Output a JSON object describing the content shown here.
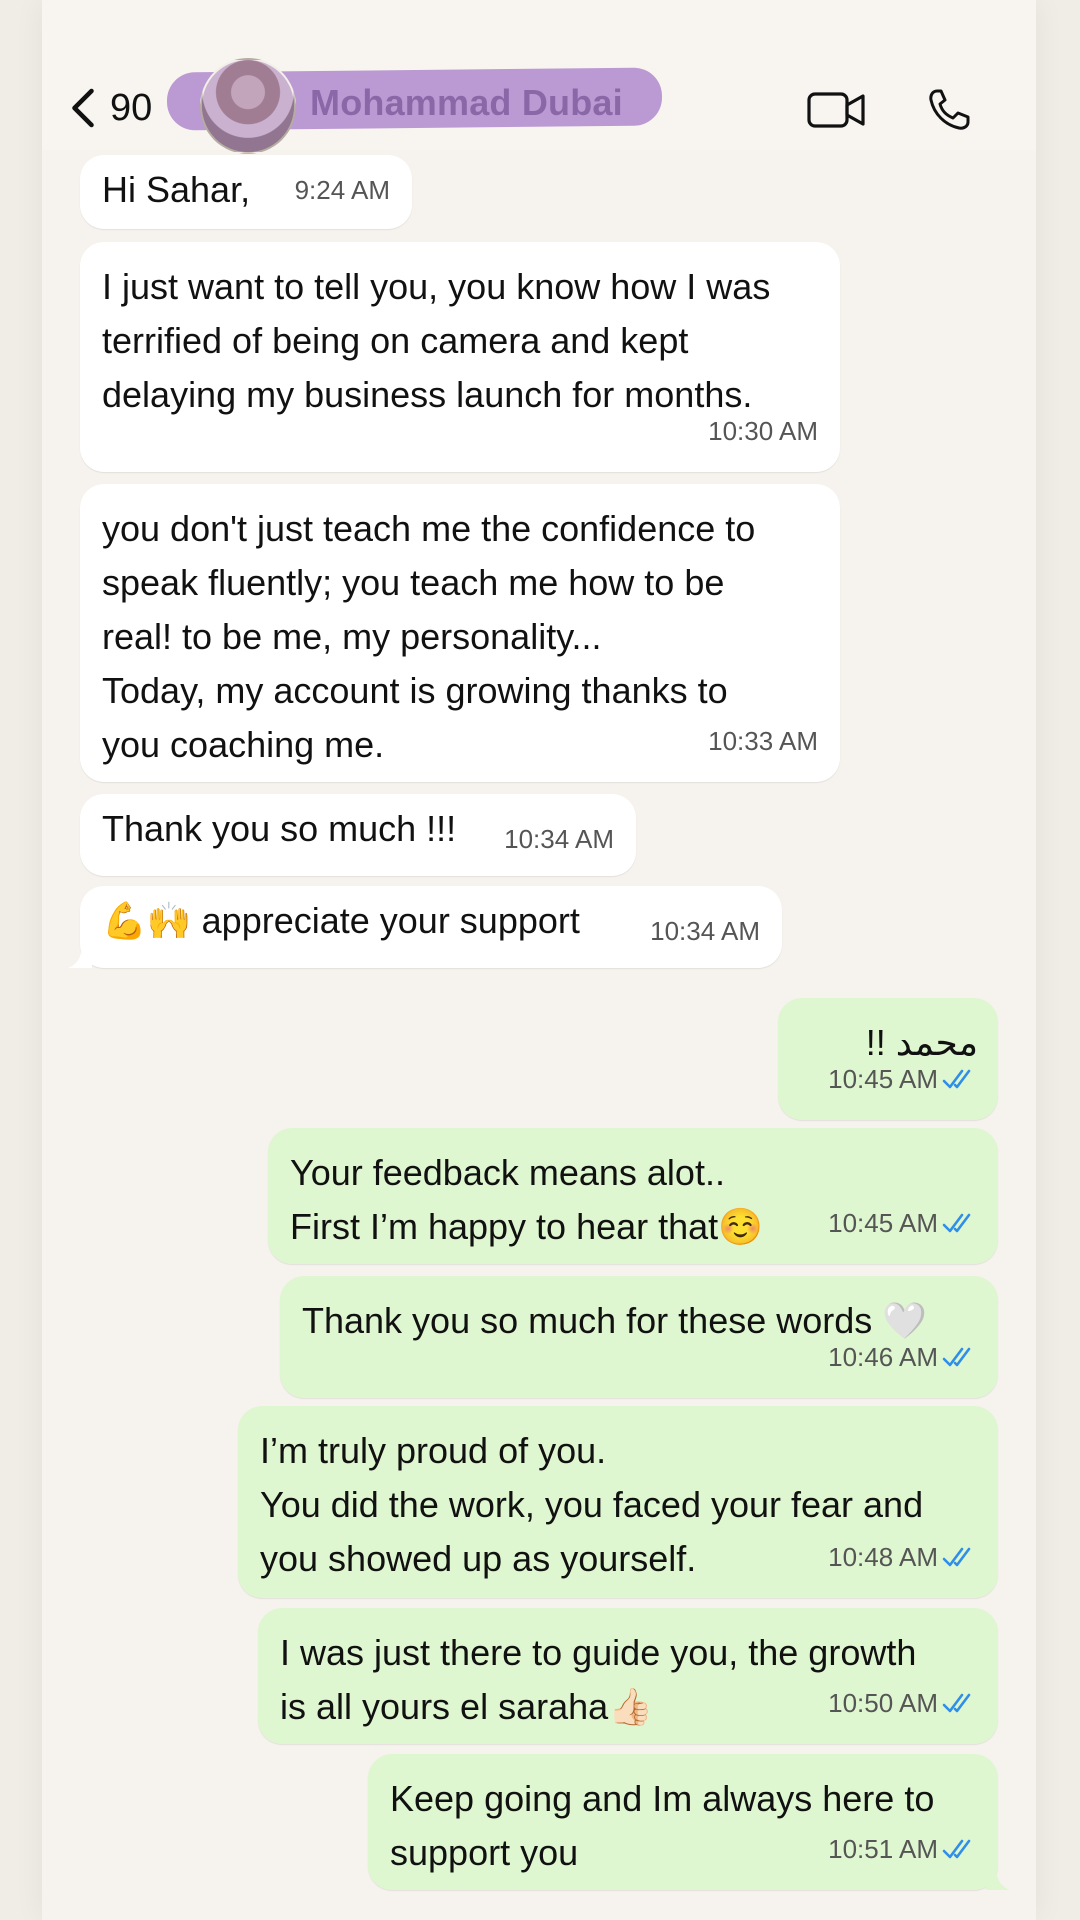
{
  "header": {
    "unread_count": "90",
    "contact_name": "Mohammad Dubai"
  },
  "messages": [
    {
      "id": "m1",
      "dir": "in",
      "text": "Hi Sahar,",
      "time": "9:24 AM"
    },
    {
      "id": "m2",
      "dir": "in",
      "text": "I just want to tell you, you know how I was\nterrified of being on camera and kept\ndelaying my business launch for months.",
      "time": "10:30 AM"
    },
    {
      "id": "m3",
      "dir": "in",
      "text": "you don't just teach me the confidence to\nspeak fluently; you teach me how to be\nreal! to be me, my personality...\nToday, my account is growing thanks to\nyou coaching me.",
      "time": "10:33 AM"
    },
    {
      "id": "m4",
      "dir": "in",
      "text": "Thank you so much !!!",
      "time": "10:34 AM"
    },
    {
      "id": "m5",
      "dir": "in",
      "text": "💪🙌 appreciate your support",
      "time": "10:34 AM"
    },
    {
      "id": "m6",
      "dir": "out",
      "text": "محمد !!",
      "time": "10:45 AM"
    },
    {
      "id": "m7",
      "dir": "out",
      "text": "Your feedback means alot..\nFirst I’m happy to hear that☺️",
      "time": "10:45 AM"
    },
    {
      "id": "m8",
      "dir": "out",
      "text": "Thank you so much for these words 🤍",
      "time": "10:46 AM"
    },
    {
      "id": "m9",
      "dir": "out",
      "text": "I’m truly proud of you.\nYou did the work, you faced your fear and\nyou showed up as yourself.",
      "time": "10:48 AM"
    },
    {
      "id": "m10",
      "dir": "out",
      "text": "I was just there to guide you, the growth\nis all yours el saraha👍🏻",
      "time": "10:50 AM"
    },
    {
      "id": "m11",
      "dir": "out",
      "text": "Keep going and Im always here to\nsupport you",
      "time": "10:51 AM"
    }
  ],
  "colors": {
    "incoming": "#ffffff",
    "outgoing": "#dff7d0",
    "read_tick": "#2f8ee8",
    "name_highlight": "#b28cce"
  },
  "icons": {
    "back": "chevron-left-icon",
    "video": "video-camera-icon",
    "call": "phone-icon",
    "read_receipt": "double-check-icon"
  }
}
